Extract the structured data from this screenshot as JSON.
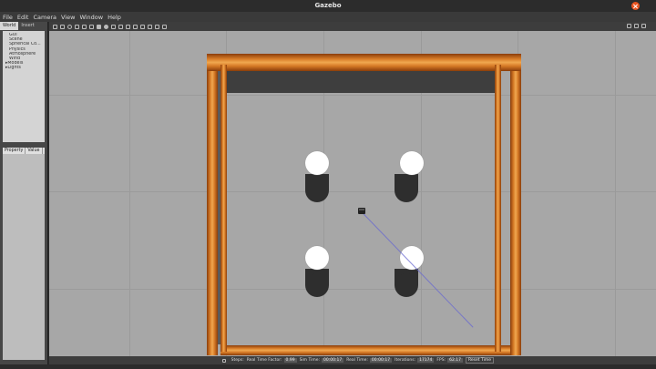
{
  "window": {
    "title": "Gazebo"
  },
  "menu": [
    "File",
    "Edit",
    "Camera",
    "View",
    "Window",
    "Help"
  ],
  "left_panel": {
    "tabs": [
      "World",
      "Insert"
    ],
    "tree_items": [
      {
        "label": "GUI",
        "expandable": false
      },
      {
        "label": "Scene",
        "expandable": false
      },
      {
        "label": "Spherical Co...",
        "expandable": false
      },
      {
        "label": "Physics",
        "expandable": false
      },
      {
        "label": "Atmosphere",
        "expandable": false
      },
      {
        "label": "Wind",
        "expandable": false
      },
      {
        "label": "Models",
        "expandable": true
      },
      {
        "label": "Lights",
        "expandable": true
      }
    ],
    "property_header": [
      "Property",
      "Value"
    ]
  },
  "bottom": {
    "steps_label": "Steps:",
    "real_time_factor_label": "Real Time Factor:",
    "real_time_factor": "0.99",
    "sim_time_label": "Sim Time:",
    "sim_time": "00:00:17",
    "real_time_label": "Real Time:",
    "real_time": "00:00:17",
    "iterations_label": "Iterations:",
    "iterations": "17174",
    "fps_label": "FPS:",
    "fps": "62.17",
    "reset_label": "Reset Time"
  },
  "colors": {
    "viewport_background": "#a7a7a7",
    "wall": "#d77b27",
    "pillar": "#ffffff",
    "accent_close": "#e95420"
  }
}
